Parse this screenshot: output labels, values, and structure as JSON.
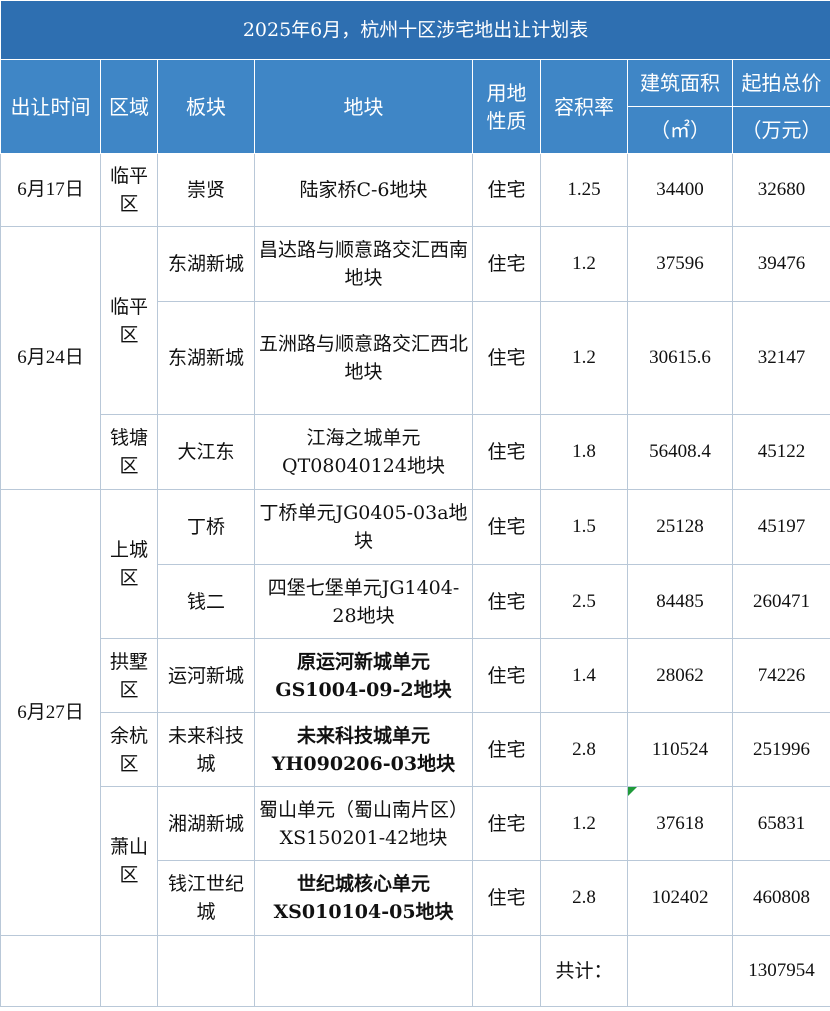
{
  "title": "2025年6月，杭州十区涉宅地出让计划表",
  "headers": {
    "date": "出让时间",
    "district": "区域",
    "block": "板块",
    "plot": "地块",
    "land_use": "用地性质",
    "far": "容积率",
    "area": "建筑面积",
    "area_unit": "（㎡）",
    "price": "起拍总价",
    "price_unit": "（万元）"
  },
  "rows": [
    {
      "date": "6月17日",
      "district": "临平区",
      "block": "崇贤",
      "plot": "陆家桥C-6地块",
      "use": "住宅",
      "far": "1.25",
      "area": "34400",
      "price": "32680"
    },
    {
      "date": "6月24日",
      "district": "临平区",
      "block": "东湖新城",
      "plot": "昌达路与顺意路交汇西南地块",
      "use": "住宅",
      "far": "1.2",
      "area": "37596",
      "price": "39476"
    },
    {
      "date": "",
      "district": "",
      "block": "东湖新城",
      "plot": "五洲路与顺意路交汇西北地块",
      "use": "住宅",
      "far": "1.2",
      "area": "30615.6",
      "price": "32147"
    },
    {
      "date": "",
      "district": "钱塘区",
      "block": "大江东",
      "plot": "江海之城单元QT08040124地块",
      "use": "住宅",
      "far": "1.8",
      "area": "56408.4",
      "price": "45122"
    },
    {
      "date": "6月27日",
      "district": "上城区",
      "block": "丁桥",
      "plot": "丁桥单元JG0405-03a地块",
      "use": "住宅",
      "far": "1.5",
      "area": "25128",
      "price": "45197"
    },
    {
      "date": "",
      "district": "",
      "block": "钱二",
      "plot": "四堡七堡单元JG1404-28地块",
      "use": "住宅",
      "far": "2.5",
      "area": "84485",
      "price": "260471"
    },
    {
      "date": "",
      "district": "拱墅区",
      "block": "运河新城",
      "plot": "原运河新城单元GS1004-09-2地块",
      "use": "住宅",
      "far": "1.4",
      "area": "28062",
      "price": "74226"
    },
    {
      "date": "",
      "district": "余杭区",
      "block": "未来科技城",
      "plot": "未来科技城单元YH090206-03地块",
      "use": "住宅",
      "far": "2.8",
      "area": "110524",
      "price": "251996"
    },
    {
      "date": "",
      "district": "萧山区",
      "block": "湘湖新城",
      "plot": "蜀山单元（蜀山南片区）XS150201-42地块",
      "use": "住宅",
      "far": "1.2",
      "area": "37618",
      "price": "65831"
    },
    {
      "date": "",
      "district": "",
      "block": "钱江世纪城",
      "plot": "世纪城核心单元XS010104-05地块",
      "use": "住宅",
      "far": "2.8",
      "area": "102402",
      "price": "460808"
    }
  ],
  "total": {
    "label": "共计：",
    "value": "1307954"
  },
  "colors": {
    "title_bg": "#2e6fb1",
    "header_bg": "#3f86c6",
    "border": "#b9c8d8",
    "comment_marker": "#1f9a3a"
  }
}
